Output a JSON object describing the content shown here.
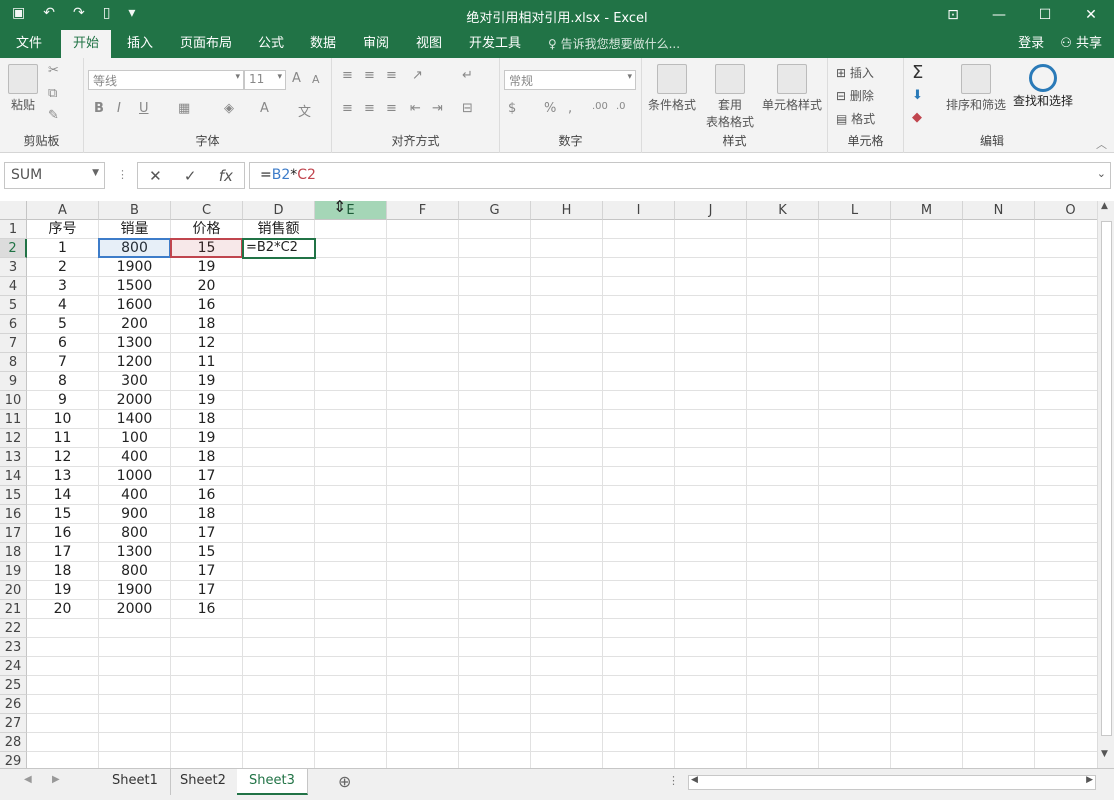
{
  "window": {
    "title": "绝对引用相对引用.xlsx - Excel",
    "quick_access": [
      "save-icon",
      "undo-icon",
      "redo-icon",
      "new-doc-icon",
      "customize-icon"
    ],
    "controls": [
      "ribbon-display-icon",
      "minimize-icon",
      "maximize-icon",
      "close-icon"
    ]
  },
  "ribbon_tabs": [
    "文件",
    "开始",
    "插入",
    "页面布局",
    "公式",
    "数据",
    "审阅",
    "视图",
    "开发工具"
  ],
  "active_tab": "开始",
  "tell_me": "告诉我您想要做什么...",
  "login": "登录",
  "share": "共享",
  "ribbon": {
    "clipboard": {
      "paste": "粘贴",
      "label": "剪贴板"
    },
    "font": {
      "family": "等线",
      "size": "11",
      "label": "字体"
    },
    "alignment": {
      "label": "对齐方式"
    },
    "number": {
      "format": "常规",
      "label": "数字"
    },
    "styles": {
      "conditional": "条件格式",
      "table_format_1": "套用",
      "table_format_2": "表格格式",
      "cell_styles": "单元格样式",
      "label": "样式"
    },
    "cells": {
      "insert": "插入",
      "delete": "删除",
      "format": "格式",
      "label": "单元格"
    },
    "editing": {
      "sort_filter": "排序和筛选",
      "find_select": "查找和选择",
      "label": "编辑"
    }
  },
  "formula_bar": {
    "name_box": "SUM",
    "formula_prefix": "=",
    "formula_ref1": "B2",
    "formula_op": "*",
    "formula_ref2": "C2"
  },
  "columns": [
    "A",
    "B",
    "C",
    "D",
    "E",
    "F",
    "G",
    "H",
    "I",
    "J",
    "K",
    "L",
    "M",
    "N",
    "O"
  ],
  "selected_column": "E",
  "rows": [
    "1",
    "2",
    "3",
    "4",
    "5",
    "6",
    "7",
    "8",
    "9",
    "10",
    "11",
    "12",
    "13",
    "14",
    "15",
    "16",
    "17",
    "18",
    "19",
    "20",
    "21",
    "22",
    "23",
    "24",
    "25",
    "26",
    "27",
    "28",
    "29"
  ],
  "selected_row": "2",
  "table": {
    "headers": [
      "序号",
      "销量",
      "价格",
      "销售额"
    ],
    "data": [
      [
        "1",
        "800",
        "15",
        "=B2*C2"
      ],
      [
        "2",
        "1900",
        "19",
        ""
      ],
      [
        "3",
        "1500",
        "20",
        ""
      ],
      [
        "4",
        "1600",
        "16",
        ""
      ],
      [
        "5",
        "200",
        "18",
        ""
      ],
      [
        "6",
        "1300",
        "12",
        ""
      ],
      [
        "7",
        "1200",
        "11",
        ""
      ],
      [
        "8",
        "300",
        "19",
        ""
      ],
      [
        "9",
        "2000",
        "19",
        ""
      ],
      [
        "10",
        "1400",
        "18",
        ""
      ],
      [
        "11",
        "100",
        "19",
        ""
      ],
      [
        "12",
        "400",
        "18",
        ""
      ],
      [
        "13",
        "1000",
        "17",
        ""
      ],
      [
        "14",
        "400",
        "16",
        ""
      ],
      [
        "15",
        "900",
        "18",
        ""
      ],
      [
        "16",
        "800",
        "17",
        ""
      ],
      [
        "17",
        "1300",
        "15",
        ""
      ],
      [
        "18",
        "800",
        "17",
        ""
      ],
      [
        "19",
        "1900",
        "17",
        ""
      ],
      [
        "20",
        "2000",
        "16",
        ""
      ]
    ]
  },
  "sheets": [
    "Sheet1",
    "Sheet2",
    "Sheet3"
  ],
  "active_sheet": "Sheet3",
  "colors": {
    "excel_green": "#217346",
    "ref_blue": "#3d7cc9",
    "ref_red": "#c0454e"
  }
}
